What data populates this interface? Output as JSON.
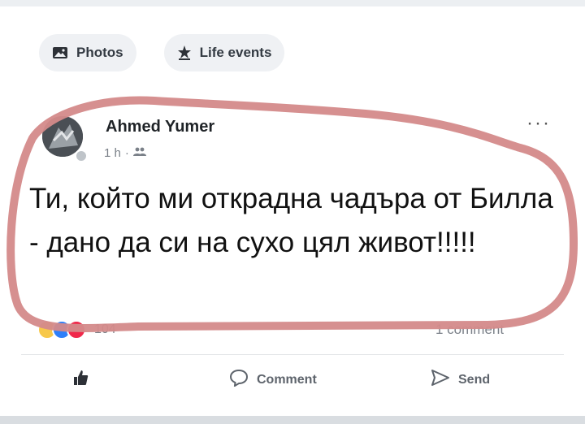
{
  "tabs": [
    {
      "label": "Photos",
      "icon": "photo-icon"
    },
    {
      "label": "Life events",
      "icon": "flag-icon"
    }
  ],
  "post": {
    "author": "Ahmed Yumer",
    "time": "1 h",
    "separator": "·",
    "audience_icon": "friends-icon",
    "more_label": "···",
    "text": "Ти, който ми открадна чадъра от Билла - дано да си на сухо цял живот!!!!!",
    "reactions_count": "104",
    "comments_count": "1 comment"
  },
  "actions": {
    "like_icon": "thumbs-up-icon",
    "comment_label": "Comment",
    "send_label": "Send"
  },
  "colors": {
    "annotation_ring": "#d48a8a",
    "like_blue": "#2d7ff9",
    "love_red": "#f0284a",
    "haha_yellow": "#f7c84a"
  }
}
